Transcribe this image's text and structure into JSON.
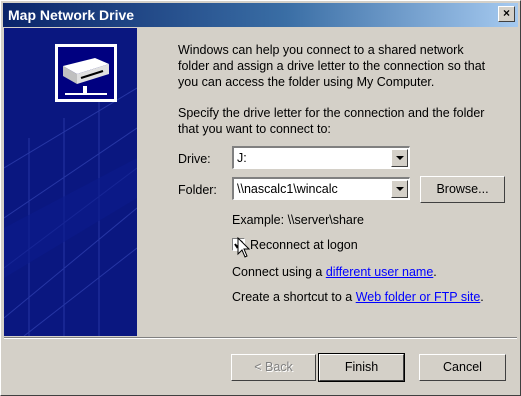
{
  "window": {
    "title": "Map Network Drive",
    "close_label": "×"
  },
  "intro": {
    "line1": "Windows can help you connect to a shared network",
    "line2": "folder and assign a drive letter to the connection so that",
    "line3": "you can access the folder using My Computer."
  },
  "instructions": {
    "line1": "Specify the drive letter for the connection and the folder",
    "line2": "that you want to connect to:"
  },
  "drive": {
    "label": "Drive:",
    "value": "J:"
  },
  "folder": {
    "label": "Folder:",
    "value": "\\\\nascalc1\\wincalc"
  },
  "browse_label": "Browse...",
  "example": "Example: \\\\server\\share",
  "reconnect": {
    "label": "Reconnect at logon",
    "checked": true
  },
  "connect_using": {
    "prefix": "Connect using a ",
    "link": "different user name",
    "suffix": "."
  },
  "shortcut": {
    "prefix": "Create a shortcut to a ",
    "link": "Web folder or FTP site",
    "suffix": "."
  },
  "buttons": {
    "back": "< Back",
    "finish": "Finish",
    "cancel": "Cancel"
  },
  "colors": {
    "title_start": "#0a246a",
    "title_end": "#a6caf0",
    "sidebar": "#0a1780",
    "link": "#0000ff"
  },
  "icons": [
    "network-drive-icon",
    "close-icon",
    "checkmark-icon",
    "dropdown-arrow-icon",
    "mouse-cursor-icon"
  ]
}
